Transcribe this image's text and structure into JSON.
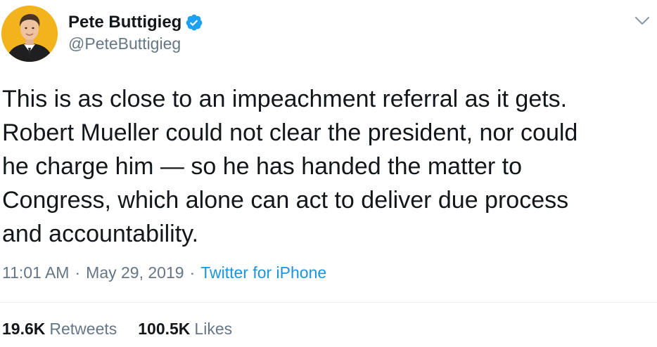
{
  "author": {
    "display_name": "Pete Buttigieg",
    "handle": "@PeteButtigieg",
    "verified": true,
    "avatar_icon": "profile-photo",
    "avatar_bg": "#f2b31d"
  },
  "tweet": {
    "text": "This is as close to an impeachment referral as it gets.\nRobert Mueller could not clear the president, nor could\nhe charge him — so he has handed the matter to\nCongress, which alone can act to deliver due process\nand accountability."
  },
  "meta": {
    "time": "11:01 AM",
    "separator": "·",
    "date": "May 29, 2019",
    "source": "Twitter for iPhone"
  },
  "stats": {
    "retweets_count": "19.6K",
    "retweets_label": "Retweets",
    "likes_count": "100.5K",
    "likes_label": "Likes"
  },
  "colors": {
    "text": "#14171a",
    "secondary": "#657786",
    "link": "#1b95e0",
    "verified_badge": "#1da1f2",
    "divider": "#e6ecf0"
  },
  "icons": {
    "verified": "verified-badge-icon",
    "menu": "chevron-down-icon"
  }
}
